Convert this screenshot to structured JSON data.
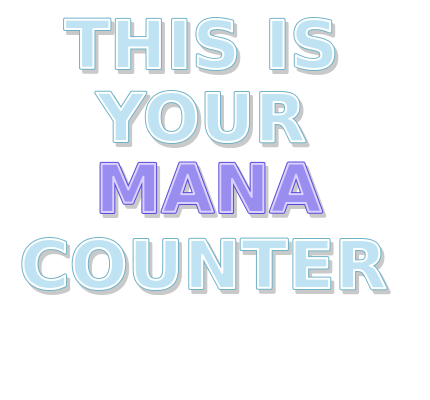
{
  "lines": [
    {
      "text": "THIS IS",
      "style": "light"
    },
    {
      "text": "YOUR",
      "style": "light"
    },
    {
      "text": "MANA",
      "style": "mana"
    },
    {
      "text": "COUNTER",
      "style": "light"
    }
  ],
  "colors": {
    "light_fill": "#bfe3f3",
    "light_outline": "#6fb3c9",
    "mana_fill": "#9a8df0",
    "mana_outline": "#5b47d9",
    "background": "#ffffff"
  }
}
